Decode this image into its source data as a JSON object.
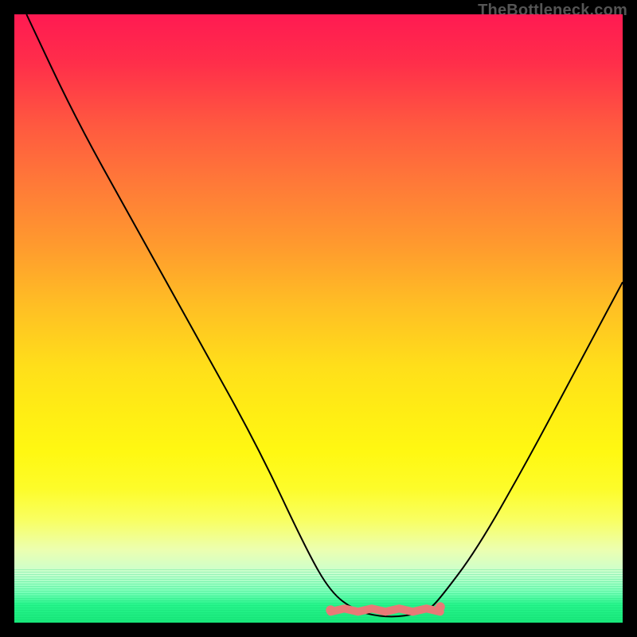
{
  "watermark": "TheBottleneck.com",
  "colors": {
    "background": "#000000",
    "curve": "#000000",
    "accent": "#e87a77",
    "gradient_top": "#ff1a52",
    "gradient_bottom": "#18e87a"
  },
  "chart_data": {
    "type": "line",
    "title": "",
    "xlabel": "",
    "ylabel": "",
    "xlim": [
      0,
      100
    ],
    "ylim": [
      0,
      100
    ],
    "grid": false,
    "legend": false,
    "background": "heatmap-gradient",
    "series": [
      {
        "name": "bottleneck-curve",
        "x": [
          2,
          10,
          20,
          30,
          40,
          48,
          52,
          56,
          60,
          64,
          68,
          70,
          76,
          84,
          92,
          100
        ],
        "y": [
          100,
          83,
          65,
          47,
          29,
          12,
          5,
          2,
          1,
          1,
          2,
          4,
          12,
          26,
          41,
          56
        ]
      }
    ],
    "highlight": {
      "name": "optimal-range",
      "x_range": [
        52,
        70
      ],
      "style": "floor-dots"
    },
    "annotations": [
      {
        "text": "TheBottleneck.com",
        "pos": "top-right",
        "role": "watermark"
      }
    ]
  }
}
